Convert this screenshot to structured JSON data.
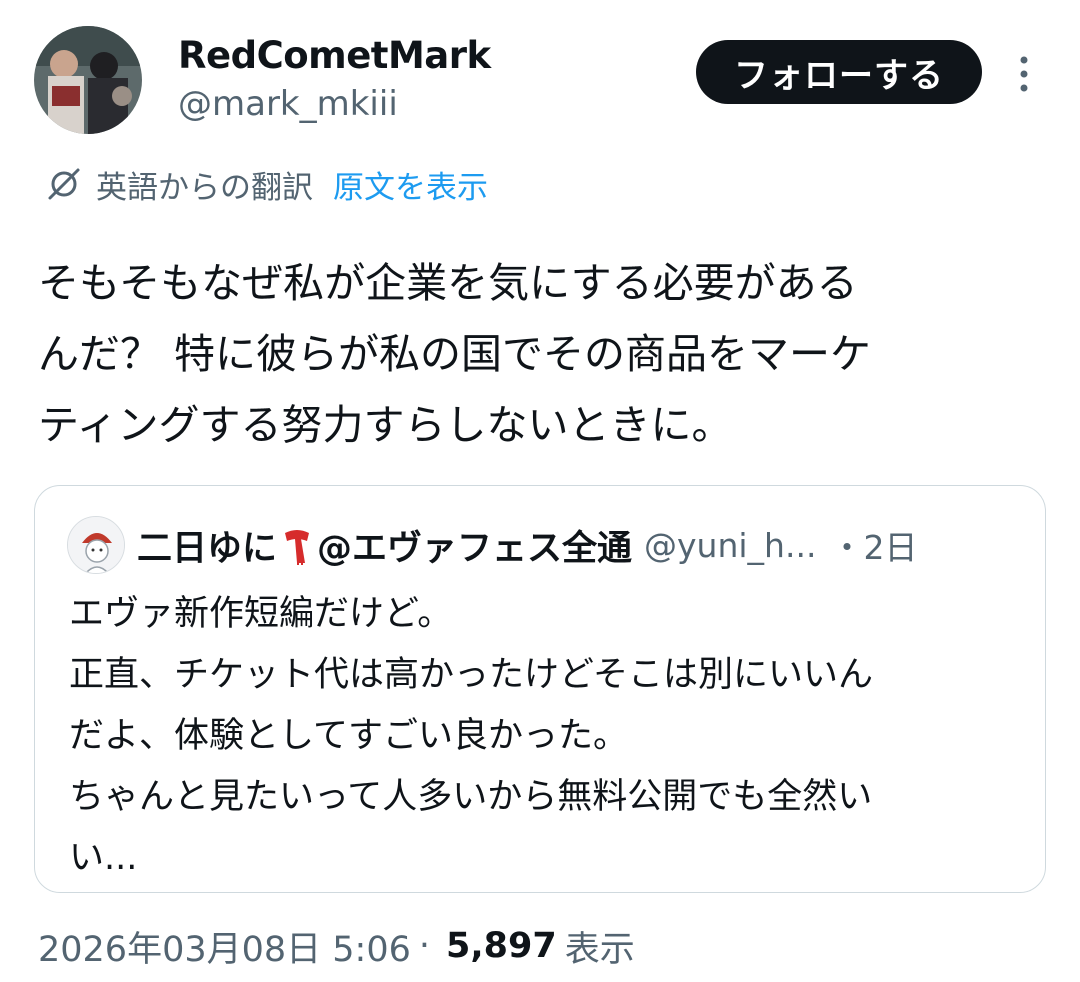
{
  "author": {
    "display_name": "RedCometMark",
    "handle": "@mark_mkiii",
    "follow_label": "フォローする"
  },
  "translation": {
    "translated_from": "英語からの翻訳",
    "show_original": "原文を表示"
  },
  "tweet": {
    "lines": [
      "そもそもなぜ私が企業を気にする必要がある",
      "んだ？ 特に彼らが私の国でその商品をマーケ",
      "ティングする努力すらしないときに。"
    ]
  },
  "quote": {
    "display_name": "二日ゆに",
    "display_name_suffix": "@エヴァフェス全通",
    "handle": "@yuni_h...",
    "time": "・2日",
    "lines": [
      "エヴァ新作短編だけど。",
      "正直、チケット代は高かったけどそこは別にいいん",
      "だよ、体験としてすごい良かった。",
      "ちゃんと見たいって人多いから無料公開でも全然い",
      "い..."
    ]
  },
  "meta": {
    "timestamp": "2026年03月08日 5:06",
    "separator": "·",
    "views": "5,897",
    "views_label": "表示"
  },
  "icons": {
    "more": "more-vertical-icon",
    "translate": "translate-icon",
    "scarf": "scarf-emoji-icon"
  },
  "colors": {
    "link": "#1d9bf0",
    "secondary_text": "#536471",
    "primary_text": "#0f1419",
    "button_bg": "#0f1419"
  }
}
